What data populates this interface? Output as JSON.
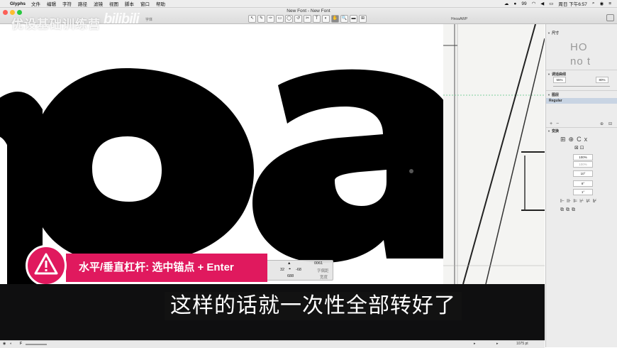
{
  "menubar": {
    "app": "Glyphs",
    "items": [
      "文件",
      "编辑",
      "字符",
      "路径",
      "滤镜",
      "视图",
      "脚本",
      "窗口",
      "帮助"
    ],
    "battery": "99",
    "clock": "周日 下午6:57"
  },
  "window": {
    "title": "New Font - New Font",
    "tab_left": "字体",
    "tab_right": "HnoaAWP",
    "tool_glyphs": [
      "↖",
      "✎",
      "✑",
      "▭",
      "◯",
      "↺",
      "✂",
      "T",
      "◐",
      "✋",
      "🔍",
      "▬",
      "⊞"
    ]
  },
  "watermark": {
    "brand": "优设基础训练营",
    "site": "bilibili"
  },
  "canvas": {
    "glyph_text": "noa"
  },
  "panel": {
    "dimensions_title": "尺寸",
    "preview_line1": "HO",
    "preview_line2": "no t",
    "fit_title": "调适曲线",
    "fit_left": "55%",
    "fit_right": "80%",
    "layers_title": "图层",
    "layer_name": "Regular",
    "transform_title": "变换",
    "scale_value": "100%",
    "scale_value_2": "100%",
    "rotate_value": "10°",
    "slant_value": "8°",
    "skew_value": "1°"
  },
  "infobox": {
    "glyph_code": "0061",
    "x": "32",
    "y": "-68",
    "width": "688",
    "label_1": "字偶距",
    "label_2": "宽度"
  },
  "tip": {
    "text": "水平/垂直杠杆: 选中锚点 + Enter"
  },
  "subtitle": {
    "text": "这样的话就一次性全部转好了"
  },
  "status": {
    "zoom": "1075 pt"
  },
  "colors": {
    "accent": "#e0195e",
    "layer_highlight": "#c8d4e3"
  }
}
